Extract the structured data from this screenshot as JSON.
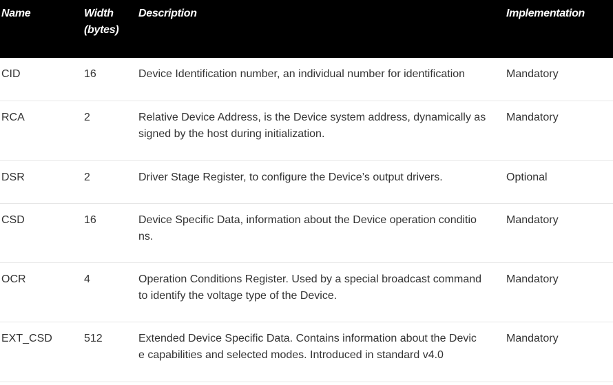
{
  "header": {
    "name": "Name",
    "width": "Width\n(bytes)",
    "description": "Description",
    "implementation": "Implementation"
  },
  "rows": [
    {
      "name": "CID",
      "width": "16",
      "description": "Device Identification number, an individual number for identification",
      "implementation": "Mandatory"
    },
    {
      "name": "RCA",
      "width": "2",
      "description": "Relative Device Address, is the Device system address, dynamically as\nsigned by the host during initialization.",
      "implementation": "Mandatory"
    },
    {
      "name": "DSR",
      "width": "2",
      "description": "Driver Stage Register, to configure the Device’s output drivers.",
      "implementation": "Optional"
    },
    {
      "name": "CSD",
      "width": "16",
      "description": "Device Specific Data, information about the Device operation conditio\nns.",
      "implementation": "Mandatory"
    },
    {
      "name": "OCR",
      "width": "4",
      "description": "Operation Conditions Register. Used by a special broadcast command\nto identify the voltage type of the Device.",
      "implementation": "Mandatory"
    },
    {
      "name": "EXT_CSD",
      "width": "512",
      "description": "Extended Device Specific Data. Contains information about the Devic\ne capabilities and selected modes. Introduced in standard v4.0",
      "implementation": "Mandatory"
    }
  ]
}
